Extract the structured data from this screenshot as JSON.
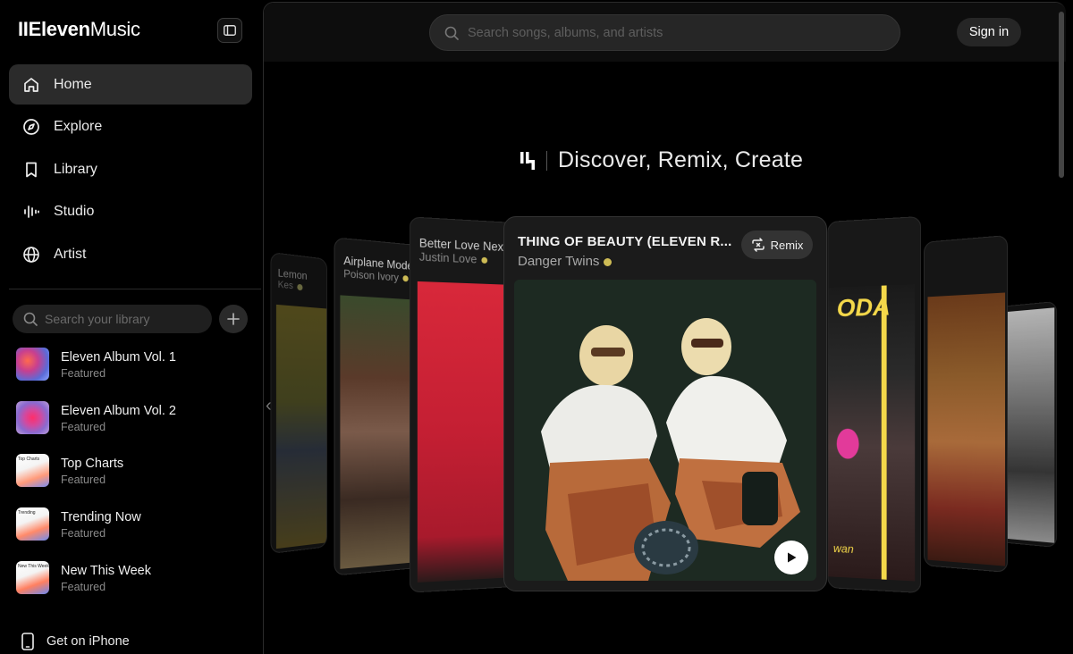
{
  "sidebar": {
    "logo_bars": "II",
    "logo_bold": "Eleven",
    "logo_light": "Music",
    "nav": [
      {
        "label": "Home",
        "icon": "home-icon"
      },
      {
        "label": "Explore",
        "icon": "compass-icon"
      },
      {
        "label": "Library",
        "icon": "bookmark-icon"
      },
      {
        "label": "Studio",
        "icon": "waveform-icon"
      },
      {
        "label": "Artist",
        "icon": "globe-icon"
      }
    ],
    "library_search_placeholder": "Search your library",
    "library": [
      {
        "title": "Eleven Album Vol. 1",
        "subtitle": "Featured"
      },
      {
        "title": "Eleven Album Vol. 2",
        "subtitle": "Featured"
      },
      {
        "title": "Top Charts",
        "subtitle": "Featured",
        "caption": "Top Charts"
      },
      {
        "title": "Trending Now",
        "subtitle": "Featured",
        "caption": "Trending"
      },
      {
        "title": "New This Week",
        "subtitle": "Featured",
        "caption": "New This Week"
      }
    ],
    "get_iphone": "Get on iPhone"
  },
  "header": {
    "search_placeholder": "Search songs, albums, and artists",
    "signin": "Sign in"
  },
  "hero": {
    "tagline": "Discover, Remix, Create"
  },
  "carousel": {
    "left_cards": [
      {
        "title": "Lemon",
        "artist": "Kes"
      },
      {
        "title": "Airplane Mode",
        "artist": "Poison Ivory"
      },
      {
        "title": "Better Love Next Ti",
        "artist": "Justin Love"
      }
    ],
    "featured": {
      "title": "THING OF BEAUTY (ELEVEN R...",
      "artist": "Danger Twins",
      "remix_label": "Remix"
    },
    "right_cover_text": "ODA",
    "right_cover_script": "wan"
  },
  "colors": {
    "accent_verified": "#cdbb55",
    "active_nav_bg": "#2b2b2b",
    "card_bg": "#1b1b1b"
  }
}
